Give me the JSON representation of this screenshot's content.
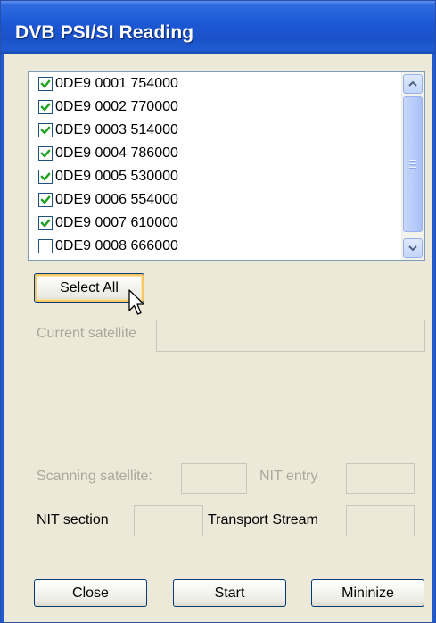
{
  "window": {
    "title": "DVB PSI/SI Reading"
  },
  "list": {
    "items": [
      {
        "label": "0DE9 0001 754000",
        "checked": true
      },
      {
        "label": "0DE9 0002 770000",
        "checked": true
      },
      {
        "label": "0DE9 0003 514000",
        "checked": true
      },
      {
        "label": "0DE9 0004 786000",
        "checked": true
      },
      {
        "label": "0DE9 0005 530000",
        "checked": true
      },
      {
        "label": "0DE9 0006 554000",
        "checked": true
      },
      {
        "label": "0DE9 0007 610000",
        "checked": true
      },
      {
        "label": "0DE9 0008 666000",
        "checked": false
      }
    ]
  },
  "buttons": {
    "select_all": "Select All",
    "close": "Close",
    "start": "Start",
    "minimize": "Mininize"
  },
  "labels": {
    "current_satellite": "Current satellite",
    "scanning_satellite": "Scanning satellite:",
    "nit_entry": "NIT entry",
    "nit_section": "NIT section",
    "transport_stream": "Transport Stream"
  },
  "colors": {
    "titlebar": "#1f5cd2",
    "dialog_bg": "#ece9d8",
    "disabled_text": "#aca899",
    "check_mark": "#21a121"
  },
  "icons": {
    "scroll_up": "chevron-up-icon",
    "scroll_down": "chevron-down-icon",
    "cursor": "mouse-pointer-icon"
  }
}
